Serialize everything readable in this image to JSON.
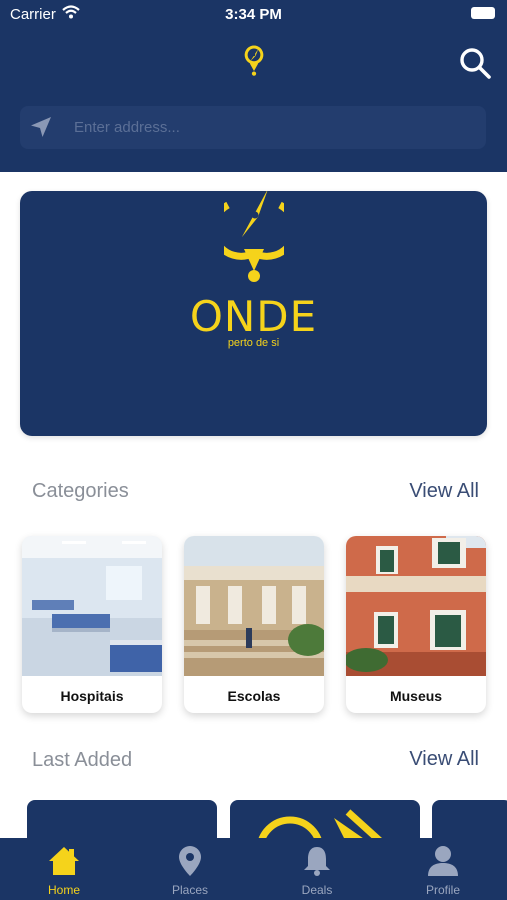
{
  "status_bar": {
    "carrier": "Carrier",
    "time": "3:34 PM"
  },
  "search": {
    "placeholder": "Enter address..."
  },
  "banner": {
    "brand": "ONDE",
    "tagline": "perto de si"
  },
  "categories": {
    "title": "Categories",
    "view_all": "View All",
    "items": [
      {
        "label": "Hospitais"
      },
      {
        "label": "Escolas"
      },
      {
        "label": "Museus"
      }
    ]
  },
  "last_added": {
    "title": "Last Added",
    "view_all": "View All"
  },
  "tabbar": {
    "items": [
      {
        "label": "Home",
        "icon": "home-icon",
        "active": true
      },
      {
        "label": "Places",
        "icon": "map-pin-icon",
        "active": false
      },
      {
        "label": "Deals",
        "icon": "bell-icon",
        "active": false
      },
      {
        "label": "Profile",
        "icon": "user-icon",
        "active": false
      }
    ]
  },
  "colors": {
    "primary": "#1b3565",
    "accent": "#f5d31b",
    "muted_text": "#8a8f98",
    "link": "#3a4d75"
  }
}
